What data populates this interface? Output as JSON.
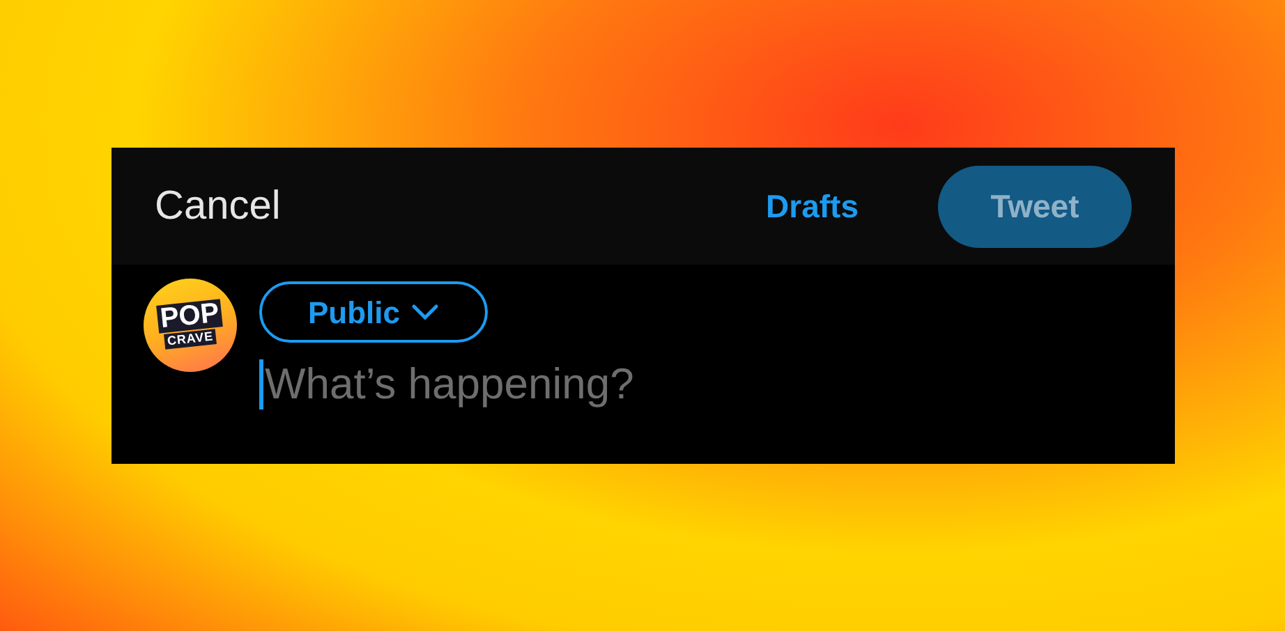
{
  "header": {
    "cancel": "Cancel",
    "drafts": "Drafts",
    "tweet_button": {
      "label": "Tweet",
      "disabled": true
    }
  },
  "avatar": {
    "line_1": "POP",
    "line_2": "CRAVE"
  },
  "audience": {
    "label": "Public"
  },
  "composer": {
    "placeholder": "What’s happening?",
    "focused": true
  }
}
